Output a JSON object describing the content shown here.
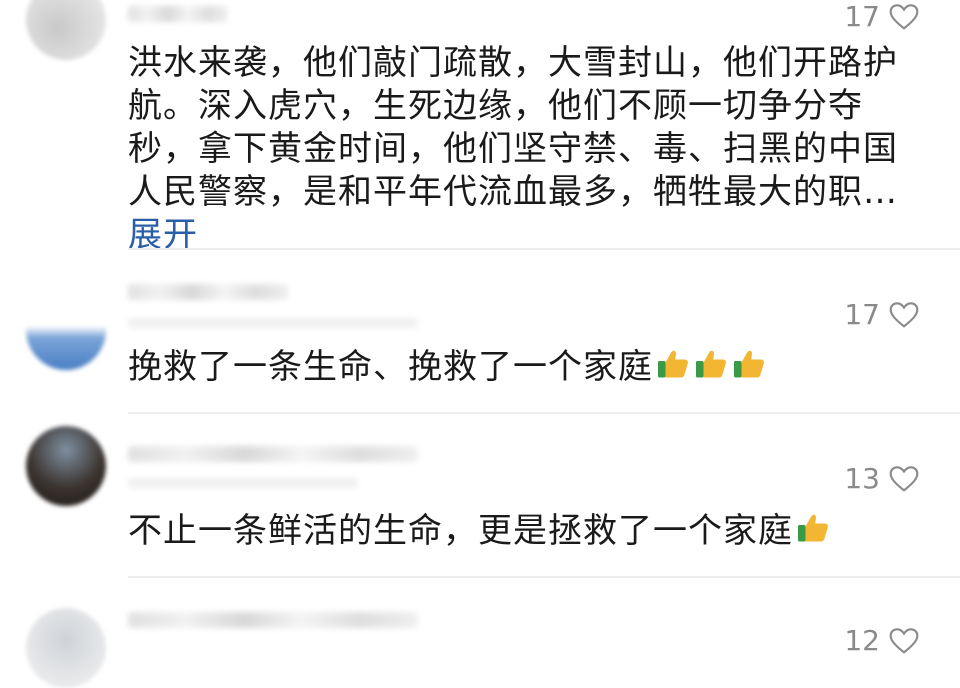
{
  "comments": [
    {
      "likes": "17",
      "text": "洪水来袭，他们敲门疏散，大雪封山，他们开路护航。深入虎穴，生死边缘，他们不顾一切争分夺秒，拿下黄金时间，他们坚守禁、毒、扫黑的中国人民警察，是和平年代流血最多，牺牲最大的职…",
      "expand_label": "展开"
    },
    {
      "likes": "17",
      "text": "挽救了一条生命、挽救了一个家庭",
      "emoji": [
        "thumbs-up",
        "thumbs-up",
        "thumbs-up"
      ]
    },
    {
      "likes": "13",
      "text": "不止一条鲜活的生命，更是拯救了一个家庭",
      "emoji": [
        "thumbs-up"
      ]
    },
    {
      "likes": "12"
    }
  ],
  "colors": {
    "expand_link": "#2a5ea8",
    "like_count": "#8a8a8a",
    "divider": "#eeeeee"
  }
}
